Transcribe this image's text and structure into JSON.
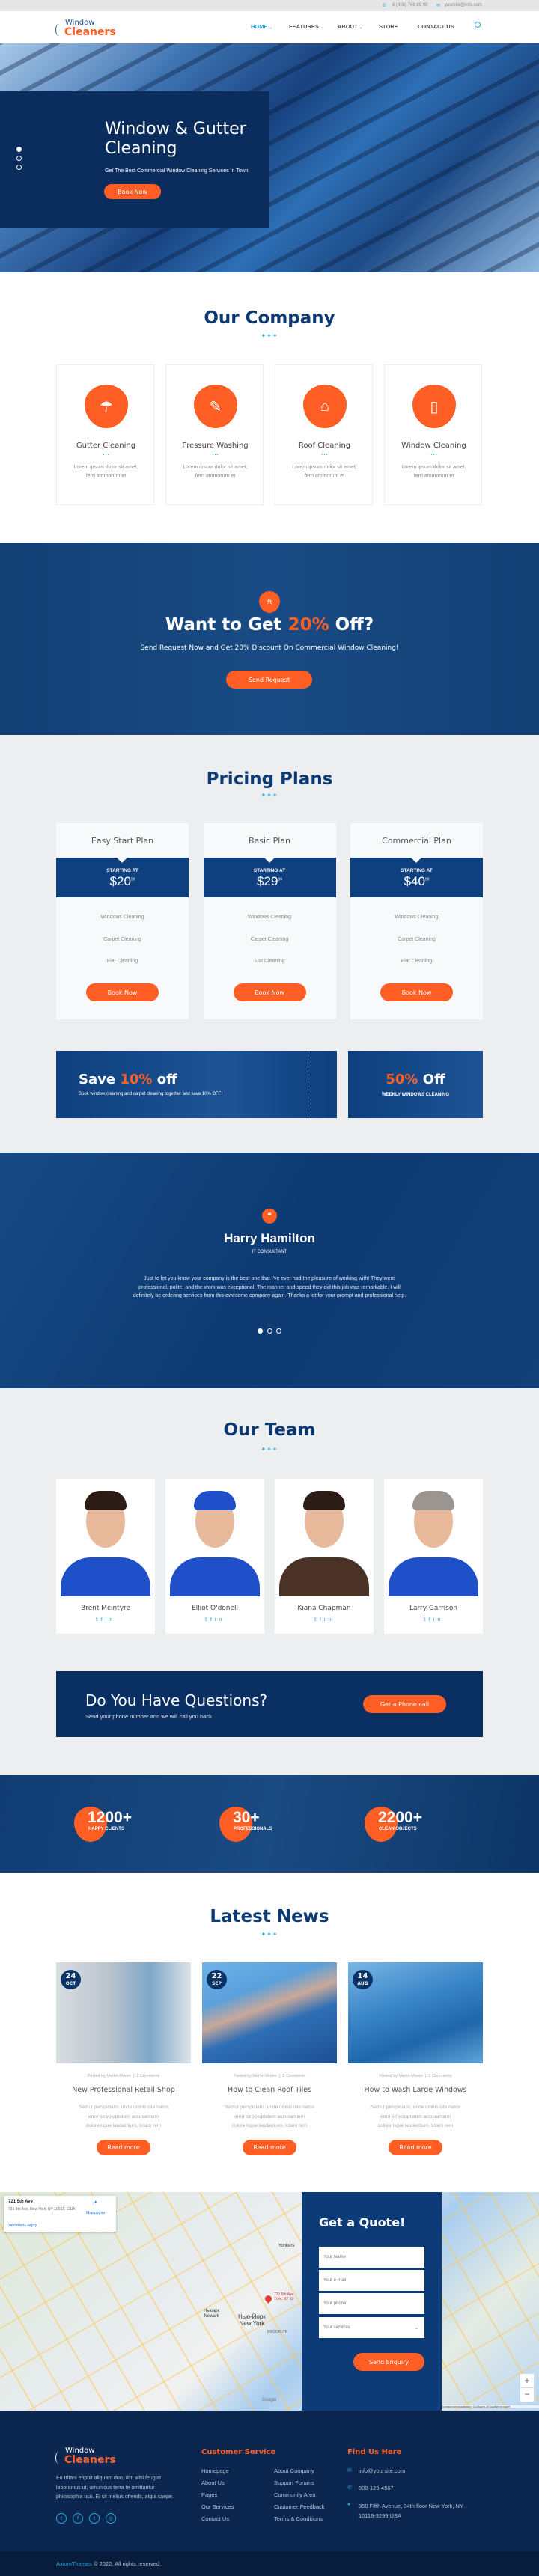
{
  "colors": {
    "navy": "#0c3366",
    "orange": "#ff5e24",
    "accent_blue": "#2aa6e0"
  },
  "topbar": {
    "phone": "8 (800) 766 89 90",
    "email": "yoursite@info.com",
    "phone_icon": "phone-icon",
    "email_icon": "envelope-icon"
  },
  "logo": {
    "line1": "Window",
    "line2": "Cleaners"
  },
  "nav": {
    "items": [
      {
        "label": "HOME",
        "active": true,
        "dropdown": true
      },
      {
        "label": "FEATURES",
        "dropdown": true
      },
      {
        "label": "ABOUT",
        "dropdown": true
      },
      {
        "label": "STORE"
      },
      {
        "label": "CONTACT US"
      }
    ],
    "search_icon": "search-icon"
  },
  "hero": {
    "title_line1": "Window & Gutter",
    "title_line2": "Cleaning",
    "subtitle": "Get The Best Commercial Window Cleaning Services In Town",
    "button": "Book Now",
    "slides": 3,
    "active_slide": 1
  },
  "company": {
    "title": "Our Company",
    "cards": [
      {
        "title": "Gutter Cleaning",
        "text1": "Lorem ipsum dolor sit amet,",
        "text2": "ferri atomorum et",
        "icon": "gutter-icon"
      },
      {
        "title": "Pressure Washing",
        "text1": "Lorem ipsum dolor sit amet,",
        "text2": "ferri atomorum et",
        "icon": "pressure-washer-icon"
      },
      {
        "title": "Roof Cleaning",
        "text1": "Lorem ipsum dolor sit amet,",
        "text2": "ferri atomorum et",
        "icon": "roof-icon"
      },
      {
        "title": "Window Cleaning",
        "text1": "Lorem ipsum dolor sit amet,",
        "text2": "ferri atomorum et",
        "icon": "window-spray-icon"
      }
    ]
  },
  "promo": {
    "icon": "%",
    "title_pre": "Want to Get ",
    "title_highlight": "20%",
    "title_post": " Off?",
    "subtitle": "Send Request Now and Get 20% Discount On Commercial Window Cleaning!",
    "button": "Send Request"
  },
  "pricing": {
    "title": "Pricing Plans",
    "starting_label": "STARTING AT",
    "plans": [
      {
        "name": "Easy Start Plan",
        "currency": "$",
        "price": "20",
        "cents": "99",
        "features": [
          "Windows Cleaning",
          "Carpet Cleaning",
          "Flat Cleaning"
        ],
        "button": "Book Now"
      },
      {
        "name": "Basic Plan",
        "currency": "$",
        "price": "29",
        "cents": "99",
        "features": [
          "Windows Cleaning",
          "Carpet Cleaning",
          "Flat Cleaning"
        ],
        "button": "Book Now"
      },
      {
        "name": "Commercial Plan",
        "currency": "$",
        "price": "40",
        "cents": "99",
        "features": [
          "Windows Cleaning",
          "Carpet Cleaning",
          "Flat Cleaning"
        ],
        "button": "Book Now"
      }
    ]
  },
  "banners": {
    "left": {
      "pre": "Save ",
      "highlight": "10%",
      "post": " off",
      "text": "Book window cleaning and carpet cleaning together and save 10% OFF!"
    },
    "right": {
      "highlight": "50%",
      "post": " Off",
      "text": "WEEKLY WINDOWS CLEANING"
    }
  },
  "testimonial": {
    "name": "Harry Hamilton",
    "role": "IT CONSULTANT",
    "line1": "Just to let you know your company is the best one that I've ever had the pleasure of working with! They were",
    "line2": "professional, polite, and the work was exceptional. The manner and speed they did this job was remarkable. I will",
    "line3": "definitely be ordering services from this awesome company again. Thanks a lot for your prompt and professional help.",
    "slides": 3,
    "active_slide": 1
  },
  "team": {
    "title": "Our Team",
    "members": [
      {
        "name": "Brent Mcintyre"
      },
      {
        "name": "Elliot O'donell"
      },
      {
        "name": "Kiana Chapman"
      },
      {
        "name": "Larry Garrison"
      }
    ],
    "social": [
      "twitter-icon",
      "facebook-icon",
      "linkedin-icon"
    ]
  },
  "questions": {
    "title": "Do You Have Questions?",
    "subtitle": "Send your phone number and we will call you back",
    "button": "Get a Phone call"
  },
  "stats": [
    {
      "value": "1200+",
      "label": "HAPPY CLIENTS"
    },
    {
      "value": "30+",
      "label": "PROFESSIONALS"
    },
    {
      "value": "2200+",
      "label": "CLEAN OBJECTS"
    }
  ],
  "news": {
    "title": "Latest News",
    "posts": [
      {
        "day": "24",
        "month": "OCT",
        "meta": "Posted by Martin Moore",
        "comments": "2 Comments",
        "title": "New Professional Retail Shop",
        "l1": "Sed ut perspiciatis, unde omnis iste natus",
        "l2": "error sit voluptatem accusantium",
        "l3": "doloremque laudantium, totam rem",
        "button": "Read more"
      },
      {
        "day": "22",
        "month": "SEP",
        "meta": "Posted by Martin Moore",
        "comments": "0 Comments",
        "title": "How to Clean Roof Tiles",
        "l1": "Sed ut perspiciatis, unde omnis iste natus",
        "l2": "error sit voluptatem accusantium",
        "l3": "doloremque laudantium, totam rem",
        "button": "Read more"
      },
      {
        "day": "14",
        "month": "AUG",
        "meta": "Posted by Martin Moore",
        "comments": "0 Comments",
        "title": "How to Wash Large Windows",
        "l1": "Sed ut perspiciatis, unde omnis iste natus",
        "l2": "error sit voluptatem accusantium",
        "l3": "doloremque laudantium, totam rem",
        "button": "Read more"
      }
    ]
  },
  "map": {
    "place": "721 5th Ave",
    "address": "721 5th Ave, New York, NY 10022, США",
    "directions": "Маршруты",
    "enlarge": "Увеличить карту",
    "pin_label": "721 5th Ave York, NY 10",
    "city_ru": "Нью-Йорк",
    "city": "New York",
    "newark_ru": "Ньюарк",
    "newark": "Newark",
    "yonkers": "Yonkers",
    "brooklyn": "BROOKLYN",
    "terms": "Условия использования",
    "report": "Сообщить об ошибке на карте",
    "zoom_in": "+",
    "zoom_out": "−",
    "google": "Google"
  },
  "quote": {
    "title": "Get a Quote!",
    "name_placeholder": "Your Name",
    "email_placeholder": "Your e-mail",
    "phone_placeholder": "Your phone",
    "services_placeholder": "Your services",
    "button": "Send Enquiry"
  },
  "footer": {
    "about": [
      "Eu tritani eripuit aliquam duo, vim wisi feugiat",
      "laboramus ut, umunicus terra te omittantur",
      "philosophia usu. Ei sit melius offendit, atqui saepe."
    ],
    "social": [
      "twitter-icon",
      "facebook-icon",
      "tumblr-icon",
      "instagram-icon"
    ],
    "service_title": "Customer Service",
    "links_col1": [
      "Homepage",
      "About Us",
      "Pages",
      "Our Services",
      "Contact Us"
    ],
    "links_col2": [
      "About Company",
      "Support Forums",
      "Community Area",
      "Customer Feedback",
      "Terms & Conditions"
    ],
    "find_title": "Find Us Here",
    "email": "info@yoursite.com",
    "phone": "800-123-4567",
    "address1": "350 Fifth Avenue, 34th floor New York, NY",
    "address2": "10118-3299 USA",
    "copyright_brand": "AxiomThemes",
    "copyright_text": " © 2022. All rights reserved."
  }
}
